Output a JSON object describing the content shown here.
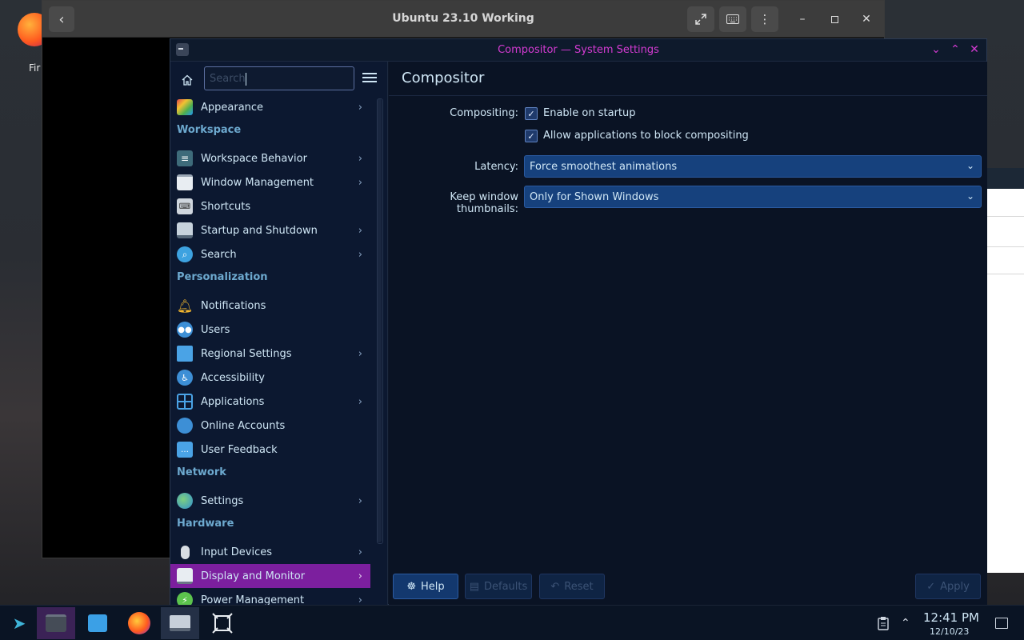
{
  "desktop": {
    "icon_label": "Fir"
  },
  "outer_window": {
    "title": "Ubuntu 23.10 Working"
  },
  "settings_window": {
    "title": "Compositor — System Settings",
    "search_placeholder": "Search",
    "sidebar": {
      "items_top": [
        {
          "label": "Appearance",
          "icon": "appearance-icon",
          "has_chevron": true
        }
      ],
      "sections": [
        {
          "title": "Workspace",
          "items": [
            {
              "label": "Workspace Behavior",
              "icon": "workspace-behavior-icon",
              "has_chevron": true
            },
            {
              "label": "Window Management",
              "icon": "window-management-icon",
              "has_chevron": true
            },
            {
              "label": "Shortcuts",
              "icon": "keyboard-icon",
              "has_chevron": false
            },
            {
              "label": "Startup and Shutdown",
              "icon": "startup-icon",
              "has_chevron": true
            },
            {
              "label": "Search",
              "icon": "search-icon",
              "has_chevron": true
            }
          ]
        },
        {
          "title": "Personalization",
          "items": [
            {
              "label": "Notifications",
              "icon": "bell-icon",
              "has_chevron": false
            },
            {
              "label": "Users",
              "icon": "users-icon",
              "has_chevron": false
            },
            {
              "label": "Regional Settings",
              "icon": "regional-icon",
              "has_chevron": true
            },
            {
              "label": "Accessibility",
              "icon": "accessibility-icon",
              "has_chevron": false
            },
            {
              "label": "Applications",
              "icon": "applications-icon",
              "has_chevron": true
            },
            {
              "label": "Online Accounts",
              "icon": "online-accounts-icon",
              "has_chevron": false
            },
            {
              "label": "User Feedback",
              "icon": "feedback-icon",
              "has_chevron": false
            }
          ]
        },
        {
          "title": "Network",
          "items": [
            {
              "label": "Settings",
              "icon": "globe-icon",
              "has_chevron": true
            }
          ]
        },
        {
          "title": "Hardware",
          "items": [
            {
              "label": "Input Devices",
              "icon": "mouse-icon",
              "has_chevron": true
            },
            {
              "label": "Display and Monitor",
              "icon": "monitor-icon",
              "has_chevron": true,
              "selected": true
            },
            {
              "label": "Power Management",
              "icon": "power-icon",
              "has_chevron": true
            }
          ]
        }
      ]
    },
    "content": {
      "page_title": "Compositor",
      "compositing_label": "Compositing:",
      "enable_on_startup": {
        "label": "Enable on startup",
        "checked": true
      },
      "allow_block": {
        "label": "Allow applications to block compositing",
        "checked": true
      },
      "latency_label": "Latency:",
      "latency_value": "Force smoothest animations",
      "thumbnails_label": "Keep window thumbnails:",
      "thumbnails_value": "Only for Shown Windows",
      "buttons": {
        "help": "Help",
        "defaults": "Defaults",
        "reset": "Reset",
        "apply": "Apply"
      }
    }
  },
  "taskbar": {
    "time": "12:41 PM",
    "date": "12/10/23"
  },
  "colors": {
    "accent_selected": "#7c1f9e",
    "title_magenta": "#d43bd2",
    "section_heading": "#6da9cf",
    "combo_bg": "#16417d"
  }
}
